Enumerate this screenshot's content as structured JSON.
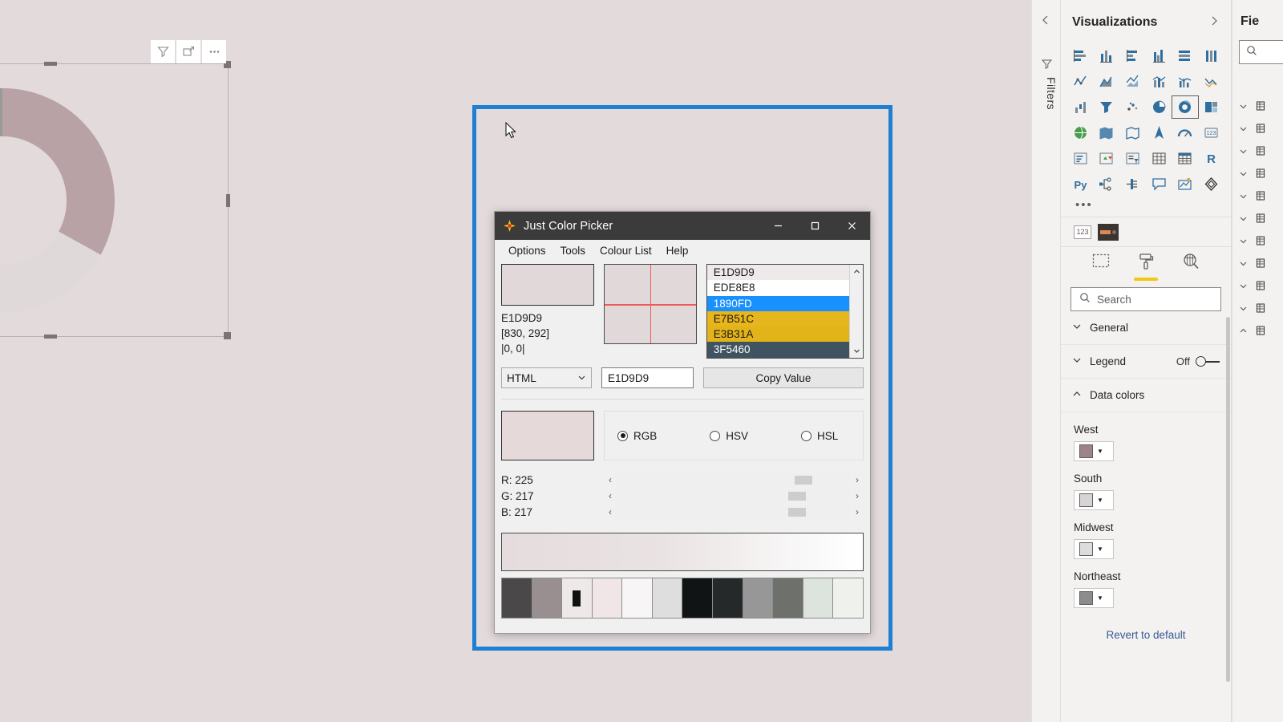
{
  "app": {
    "canvas_bg": "#e3dadb",
    "selection_color": "#1e7fd4"
  },
  "report_visual": {
    "toolbar": [
      {
        "name": "filter-icon",
        "label": "Filters"
      },
      {
        "name": "focus-mode-icon",
        "label": "Focus mode"
      },
      {
        "name": "more-options-icon",
        "label": "More options"
      }
    ],
    "chart_data": {
      "type": "pie",
      "title": "",
      "labels": [
        "West",
        "South",
        "Midwest",
        "Northeast"
      ],
      "values": [
        30,
        22,
        26,
        22
      ],
      "colors": [
        "#b9a2a5",
        "#d6d8d3",
        "#e0d9da",
        "#9a9a96"
      ],
      "donut": true,
      "legend": "off"
    }
  },
  "color_picker": {
    "title": "Just Color Picker",
    "window_controls": {
      "minimize": "minimize-icon",
      "maximize": "maximize-icon",
      "close": "close-icon"
    },
    "menu": [
      "Options",
      "Tools",
      "Colour List",
      "Help"
    ],
    "preview_color": "#E1D9D9",
    "hex_label": "E1D9D9",
    "coordinates": "[830, 292]",
    "offset": "|0, 0|",
    "color_list": [
      {
        "hex": "E1D9D9",
        "bg": "#efeaea",
        "fg": "#1b1b1b",
        "selected": false
      },
      {
        "hex": "EDE8E8",
        "bg": "#ffffff",
        "fg": "#1b1b1b",
        "selected": false
      },
      {
        "hex": "1890FD",
        "bg": "#1890fd",
        "fg": "#ffffff",
        "selected": true
      },
      {
        "hex": "E7B51C",
        "bg": "#e7b51c",
        "fg": "#1b1b1b",
        "selected": false
      },
      {
        "hex": "E3B31A",
        "bg": "#e3b31a",
        "fg": "#1b1b1b",
        "selected": false
      },
      {
        "hex": "3F5460",
        "bg": "#3f5460",
        "fg": "#ffffff",
        "selected": false
      }
    ],
    "format_select": "HTML",
    "value_field": "E1D9D9",
    "copy_button": "Copy Value",
    "color_model": {
      "options": [
        "RGB",
        "HSV",
        "HSL"
      ],
      "selected": "RGB"
    },
    "channels": [
      {
        "label": "R: 225",
        "value": 225
      },
      {
        "label": "G: 217",
        "value": 217
      },
      {
        "label": "B: 217",
        "value": 217
      }
    ],
    "palette": [
      "#4b4849",
      "#998f90",
      "#efe8e8",
      "#f0e6e7",
      "#f7f5f5",
      "#dedede",
      "#111415",
      "#25292a",
      "#979798",
      "#6e706b",
      "#dde3dd",
      "#eef1ec"
    ],
    "palette_marker_index": 2
  },
  "visualizations_pane": {
    "title": "Visualizations",
    "collapse_icon": "chevron-left-icon",
    "expand_icon": "chevron-right-icon",
    "more_icon": "ellipsis-icon",
    "icons": [
      "stacked-bar-chart-icon",
      "stacked-column-chart-icon",
      "clustered-bar-chart-icon",
      "clustered-column-chart-icon",
      "100-stacked-bar-chart-icon",
      "100-stacked-column-chart-icon",
      "line-chart-icon",
      "area-chart-icon",
      "stacked-area-chart-icon",
      "line-stacked-column-icon",
      "line-clustered-column-icon",
      "ribbon-chart-icon",
      "waterfall-chart-icon",
      "funnel-icon",
      "scatter-chart-icon",
      "pie-chart-icon",
      "donut-chart-icon",
      "treemap-icon",
      "map-icon",
      "filled-map-icon",
      "shape-map-icon",
      "arcgis-map-icon",
      "gauge-icon",
      "card-icon",
      "multi-row-card-icon",
      "kpi-icon",
      "slicer-icon",
      "table-icon",
      "matrix-icon",
      "r-script-visual-icon",
      "python-visual-icon",
      "decomposition-tree-icon",
      "key-influencers-icon",
      "qna-icon",
      "smart-narrative-icon",
      "paginated-report-icon"
    ],
    "selected_icon_index": 16,
    "field_row": {
      "numeric_icon": "123-icon",
      "theme_swatch": "theme-color-icon"
    },
    "format_tabs": [
      {
        "name": "fields-tab-icon",
        "active": false
      },
      {
        "name": "format-paint-roller-icon",
        "active": true
      },
      {
        "name": "analytics-magnifier-icon",
        "active": false
      }
    ],
    "search": {
      "placeholder": "Search",
      "icon": "search-icon"
    },
    "sections": [
      {
        "label": "General",
        "expanded": false,
        "toggle": null
      },
      {
        "label": "Legend",
        "expanded": false,
        "toggle": "Off"
      },
      {
        "label": "Data colors",
        "expanded": true,
        "toggle": null
      }
    ],
    "data_colors": [
      {
        "label": "West",
        "color": "#9c8489"
      },
      {
        "label": "South",
        "color": "#d6d4d4"
      },
      {
        "label": "Midwest",
        "color": "#dcdcdc"
      },
      {
        "label": "Northeast",
        "color": "#8c8c8c"
      }
    ],
    "revert_link": "Revert to default"
  },
  "filters_rail": {
    "label": "Filters",
    "icon": "filter-outline-icon",
    "collapse_icon": "chevron-left-icon"
  },
  "fields_pane": {
    "title": "Fie",
    "search_icon": "search-icon",
    "rows": 11
  }
}
